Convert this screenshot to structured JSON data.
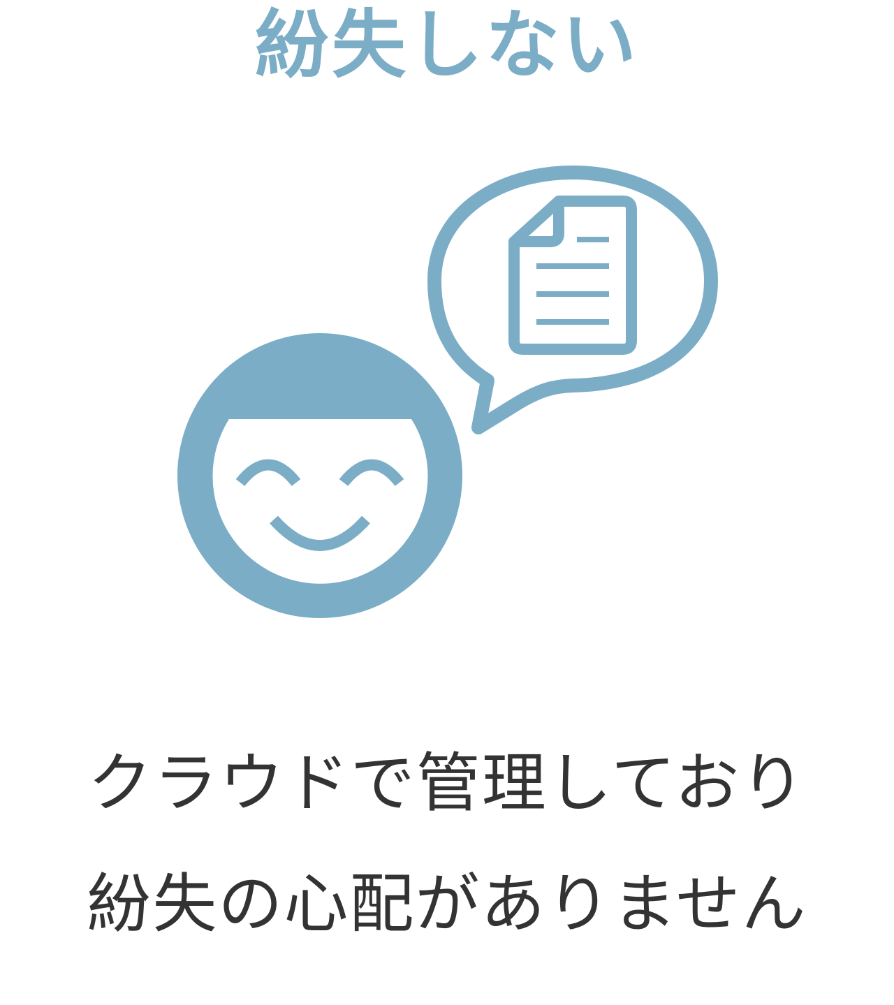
{
  "colors": {
    "accent": "#7badc6",
    "text": "#333333",
    "background": "#ffffff"
  },
  "heading": {
    "text": "紛失しない"
  },
  "illustration": {
    "icons": [
      "smiling-face-icon",
      "speech-bubble-icon",
      "document-icon"
    ]
  },
  "caption": {
    "line1": "クラウドで管理しており",
    "line2": "紛失の心配がありません"
  }
}
